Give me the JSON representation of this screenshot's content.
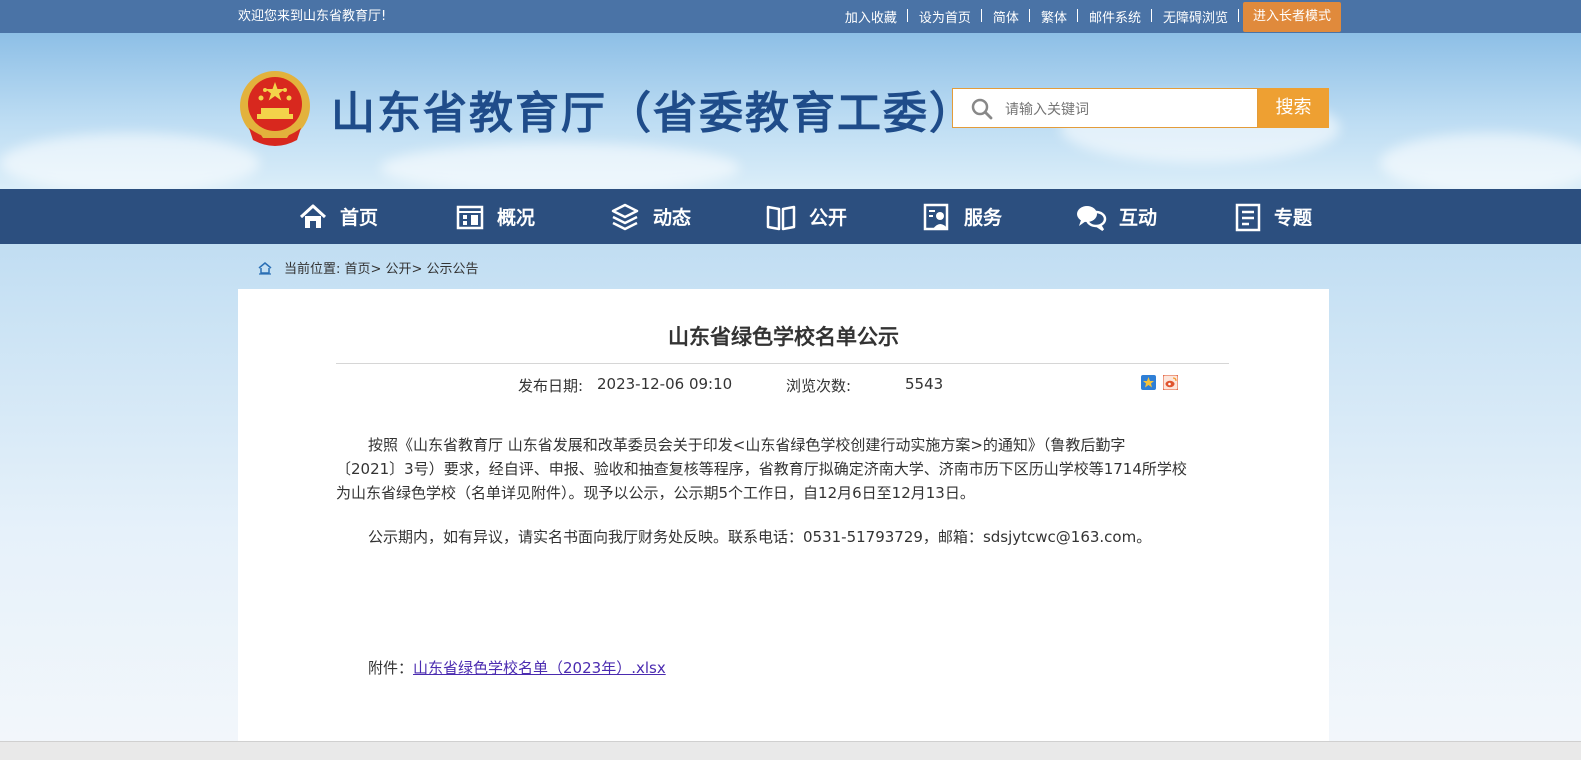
{
  "topbar": {
    "welcome": "欢迎您来到山东省教育厅!",
    "links": [
      "加入收藏",
      "设为首页",
      "简体",
      "繁体",
      "邮件系统",
      "无障碍浏览"
    ],
    "elder_mode": "进入长者模式"
  },
  "header": {
    "title": "山东省教育厅（省委教育工委）",
    "search_placeholder": "请输入关键词",
    "search_button": "搜索"
  },
  "nav": {
    "items": [
      {
        "label": "首页",
        "icon": "home-icon"
      },
      {
        "label": "概况",
        "icon": "building-icon"
      },
      {
        "label": "动态",
        "icon": "layers-icon"
      },
      {
        "label": "公开",
        "icon": "book-icon"
      },
      {
        "label": "服务",
        "icon": "service-icon"
      },
      {
        "label": "互动",
        "icon": "chat-icon"
      },
      {
        "label": "专题",
        "icon": "document-icon"
      }
    ]
  },
  "breadcrumb": {
    "text": "当前位置: 首页>  公开>  公示公告"
  },
  "article": {
    "title": "山东省绿色学校名单公示",
    "date_label": "发布日期:",
    "date_value": "2023-12-06 09:10",
    "views_label": "浏览次数:",
    "views_value": "5543",
    "paragraph1_lines": [
      "按照《山东省教育厅 山东省发展和改革委员会关于印发<山东省绿色学校创建行动实施方案>的通知》（鲁教后勤字",
      "〔2021〕3号）要求，经自评、申报、验收和抽查复核等程序，省教育厅拟确定济南大学、济南市历下区历山学校等1714所学校",
      "为山东省绿色学校（名单详见附件）。现予以公示，公示期5个工作日，自12月6日至12月13日。"
    ],
    "paragraph2": "公示期内，如有异议，请实名书面向我厅财务处反映。联系电话：0531-51793729，邮箱：sdsjytcwc@163.com。",
    "attachment_label": "附件：",
    "attachment_link": "山东省绿色学校名单（2023年）.xlsx"
  },
  "colors": {
    "topbar": "#4a73a6",
    "nav": "#2c4f7f",
    "accent": "#eea032",
    "title": "#1f4c8a"
  }
}
